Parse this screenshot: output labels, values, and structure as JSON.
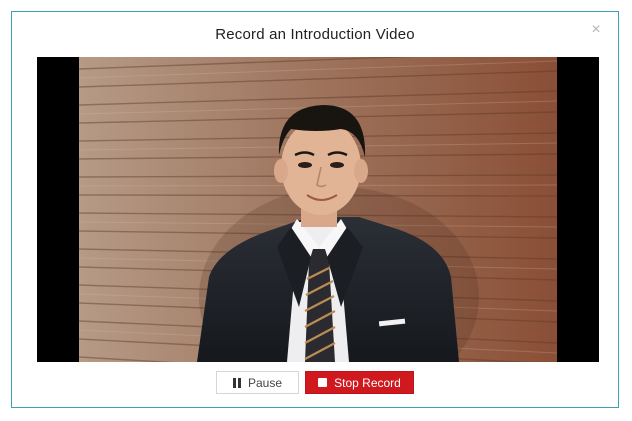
{
  "modal": {
    "title": "Record an Introduction Video",
    "close_icon": "close-icon",
    "close_glyph": "×"
  },
  "video": {
    "subject": "live-camera-preview"
  },
  "controls": {
    "pause_label": "Pause",
    "pause_icon": "pause-icon",
    "stop_label": "Stop Record",
    "stop_icon": "stop-icon"
  },
  "colors": {
    "modal_border": "#3f9fb8",
    "stop_button": "#d0191f",
    "letterbox": "#000000"
  }
}
